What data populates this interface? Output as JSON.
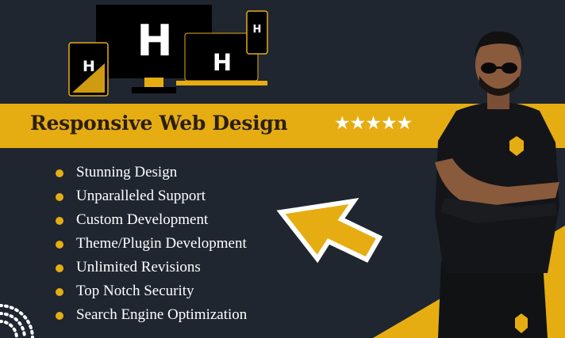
{
  "banner": {
    "title": "Responsive Web Design",
    "stars": "★★★★★",
    "rating": 5,
    "logo_letter": "H"
  },
  "features": [
    "Stunning Design",
    "Unparalleled Support",
    "Custom Development",
    "Theme/Plugin Development",
    "Unlimited Revisions",
    "Top Notch Security",
    "Search Engine Optimization"
  ],
  "colors": {
    "background": "#1f2630",
    "accent": "#e6ad13",
    "title_text": "#2b1f14",
    "text": "#ffffff",
    "device": "#000000"
  },
  "icons": [
    "pointer-arrow-icon",
    "h-logo-icon",
    "star-icon",
    "crest-emblem-icon"
  ]
}
